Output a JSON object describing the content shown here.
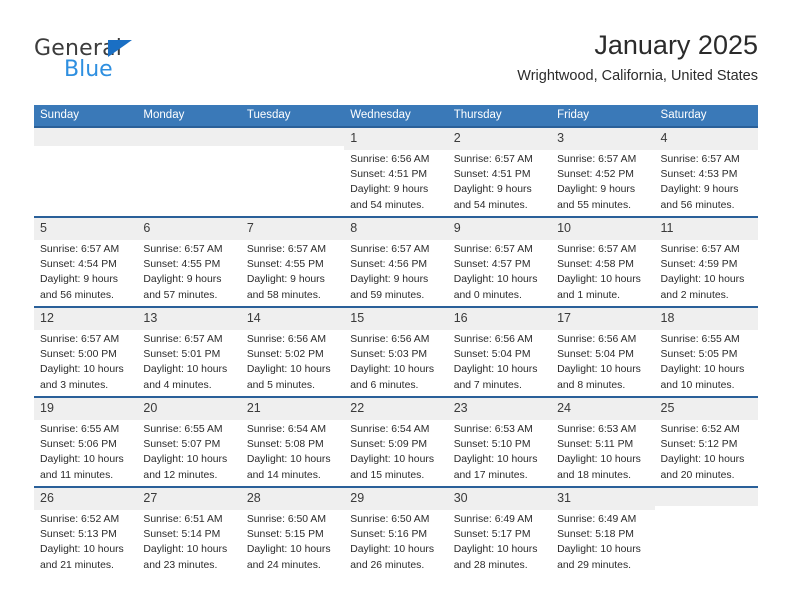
{
  "brand": {
    "name_top": "General",
    "name_bottom": "Blue",
    "triangle_color": "#1a6fc4",
    "blue_color": "#2e8fe0"
  },
  "header": {
    "title": "January 2025",
    "subtitle": "Wrightwood, California, United States"
  },
  "colors": {
    "header_row_bg": "#3a79b8",
    "row_border": "#2a6099",
    "daynum_bg": "#efefef",
    "text": "#2b2b2b"
  },
  "weekday_headers": [
    "Sunday",
    "Monday",
    "Tuesday",
    "Wednesday",
    "Thursday",
    "Friday",
    "Saturday"
  ],
  "labels": {
    "sunrise_prefix": "Sunrise:",
    "sunset_prefix": "Sunset:",
    "daylight_prefix": "Daylight:"
  },
  "weeks": [
    [
      {
        "day": "",
        "empty": true
      },
      {
        "day": "",
        "empty": true
      },
      {
        "day": "",
        "empty": true
      },
      {
        "day": "1",
        "sunrise": "Sunrise: 6:56 AM",
        "sunset": "Sunset: 4:51 PM",
        "daylight1": "Daylight: 9 hours",
        "daylight2": "and 54 minutes."
      },
      {
        "day": "2",
        "sunrise": "Sunrise: 6:57 AM",
        "sunset": "Sunset: 4:51 PM",
        "daylight1": "Daylight: 9 hours",
        "daylight2": "and 54 minutes."
      },
      {
        "day": "3",
        "sunrise": "Sunrise: 6:57 AM",
        "sunset": "Sunset: 4:52 PM",
        "daylight1": "Daylight: 9 hours",
        "daylight2": "and 55 minutes."
      },
      {
        "day": "4",
        "sunrise": "Sunrise: 6:57 AM",
        "sunset": "Sunset: 4:53 PM",
        "daylight1": "Daylight: 9 hours",
        "daylight2": "and 56 minutes."
      }
    ],
    [
      {
        "day": "5",
        "sunrise": "Sunrise: 6:57 AM",
        "sunset": "Sunset: 4:54 PM",
        "daylight1": "Daylight: 9 hours",
        "daylight2": "and 56 minutes."
      },
      {
        "day": "6",
        "sunrise": "Sunrise: 6:57 AM",
        "sunset": "Sunset: 4:55 PM",
        "daylight1": "Daylight: 9 hours",
        "daylight2": "and 57 minutes."
      },
      {
        "day": "7",
        "sunrise": "Sunrise: 6:57 AM",
        "sunset": "Sunset: 4:55 PM",
        "daylight1": "Daylight: 9 hours",
        "daylight2": "and 58 minutes."
      },
      {
        "day": "8",
        "sunrise": "Sunrise: 6:57 AM",
        "sunset": "Sunset: 4:56 PM",
        "daylight1": "Daylight: 9 hours",
        "daylight2": "and 59 minutes."
      },
      {
        "day": "9",
        "sunrise": "Sunrise: 6:57 AM",
        "sunset": "Sunset: 4:57 PM",
        "daylight1": "Daylight: 10 hours",
        "daylight2": "and 0 minutes."
      },
      {
        "day": "10",
        "sunrise": "Sunrise: 6:57 AM",
        "sunset": "Sunset: 4:58 PM",
        "daylight1": "Daylight: 10 hours",
        "daylight2": "and 1 minute."
      },
      {
        "day": "11",
        "sunrise": "Sunrise: 6:57 AM",
        "sunset": "Sunset: 4:59 PM",
        "daylight1": "Daylight: 10 hours",
        "daylight2": "and 2 minutes."
      }
    ],
    [
      {
        "day": "12",
        "sunrise": "Sunrise: 6:57 AM",
        "sunset": "Sunset: 5:00 PM",
        "daylight1": "Daylight: 10 hours",
        "daylight2": "and 3 minutes."
      },
      {
        "day": "13",
        "sunrise": "Sunrise: 6:57 AM",
        "sunset": "Sunset: 5:01 PM",
        "daylight1": "Daylight: 10 hours",
        "daylight2": "and 4 minutes."
      },
      {
        "day": "14",
        "sunrise": "Sunrise: 6:56 AM",
        "sunset": "Sunset: 5:02 PM",
        "daylight1": "Daylight: 10 hours",
        "daylight2": "and 5 minutes."
      },
      {
        "day": "15",
        "sunrise": "Sunrise: 6:56 AM",
        "sunset": "Sunset: 5:03 PM",
        "daylight1": "Daylight: 10 hours",
        "daylight2": "and 6 minutes."
      },
      {
        "day": "16",
        "sunrise": "Sunrise: 6:56 AM",
        "sunset": "Sunset: 5:04 PM",
        "daylight1": "Daylight: 10 hours",
        "daylight2": "and 7 minutes."
      },
      {
        "day": "17",
        "sunrise": "Sunrise: 6:56 AM",
        "sunset": "Sunset: 5:04 PM",
        "daylight1": "Daylight: 10 hours",
        "daylight2": "and 8 minutes."
      },
      {
        "day": "18",
        "sunrise": "Sunrise: 6:55 AM",
        "sunset": "Sunset: 5:05 PM",
        "daylight1": "Daylight: 10 hours",
        "daylight2": "and 10 minutes."
      }
    ],
    [
      {
        "day": "19",
        "sunrise": "Sunrise: 6:55 AM",
        "sunset": "Sunset: 5:06 PM",
        "daylight1": "Daylight: 10 hours",
        "daylight2": "and 11 minutes."
      },
      {
        "day": "20",
        "sunrise": "Sunrise: 6:55 AM",
        "sunset": "Sunset: 5:07 PM",
        "daylight1": "Daylight: 10 hours",
        "daylight2": "and 12 minutes."
      },
      {
        "day": "21",
        "sunrise": "Sunrise: 6:54 AM",
        "sunset": "Sunset: 5:08 PM",
        "daylight1": "Daylight: 10 hours",
        "daylight2": "and 14 minutes."
      },
      {
        "day": "22",
        "sunrise": "Sunrise: 6:54 AM",
        "sunset": "Sunset: 5:09 PM",
        "daylight1": "Daylight: 10 hours",
        "daylight2": "and 15 minutes."
      },
      {
        "day": "23",
        "sunrise": "Sunrise: 6:53 AM",
        "sunset": "Sunset: 5:10 PM",
        "daylight1": "Daylight: 10 hours",
        "daylight2": "and 17 minutes."
      },
      {
        "day": "24",
        "sunrise": "Sunrise: 6:53 AM",
        "sunset": "Sunset: 5:11 PM",
        "daylight1": "Daylight: 10 hours",
        "daylight2": "and 18 minutes."
      },
      {
        "day": "25",
        "sunrise": "Sunrise: 6:52 AM",
        "sunset": "Sunset: 5:12 PM",
        "daylight1": "Daylight: 10 hours",
        "daylight2": "and 20 minutes."
      }
    ],
    [
      {
        "day": "26",
        "sunrise": "Sunrise: 6:52 AM",
        "sunset": "Sunset: 5:13 PM",
        "daylight1": "Daylight: 10 hours",
        "daylight2": "and 21 minutes."
      },
      {
        "day": "27",
        "sunrise": "Sunrise: 6:51 AM",
        "sunset": "Sunset: 5:14 PM",
        "daylight1": "Daylight: 10 hours",
        "daylight2": "and 23 minutes."
      },
      {
        "day": "28",
        "sunrise": "Sunrise: 6:50 AM",
        "sunset": "Sunset: 5:15 PM",
        "daylight1": "Daylight: 10 hours",
        "daylight2": "and 24 minutes."
      },
      {
        "day": "29",
        "sunrise": "Sunrise: 6:50 AM",
        "sunset": "Sunset: 5:16 PM",
        "daylight1": "Daylight: 10 hours",
        "daylight2": "and 26 minutes."
      },
      {
        "day": "30",
        "sunrise": "Sunrise: 6:49 AM",
        "sunset": "Sunset: 5:17 PM",
        "daylight1": "Daylight: 10 hours",
        "daylight2": "and 28 minutes."
      },
      {
        "day": "31",
        "sunrise": "Sunrise: 6:49 AM",
        "sunset": "Sunset: 5:18 PM",
        "daylight1": "Daylight: 10 hours",
        "daylight2": "and 29 minutes."
      },
      {
        "day": "",
        "empty": true
      }
    ]
  ]
}
